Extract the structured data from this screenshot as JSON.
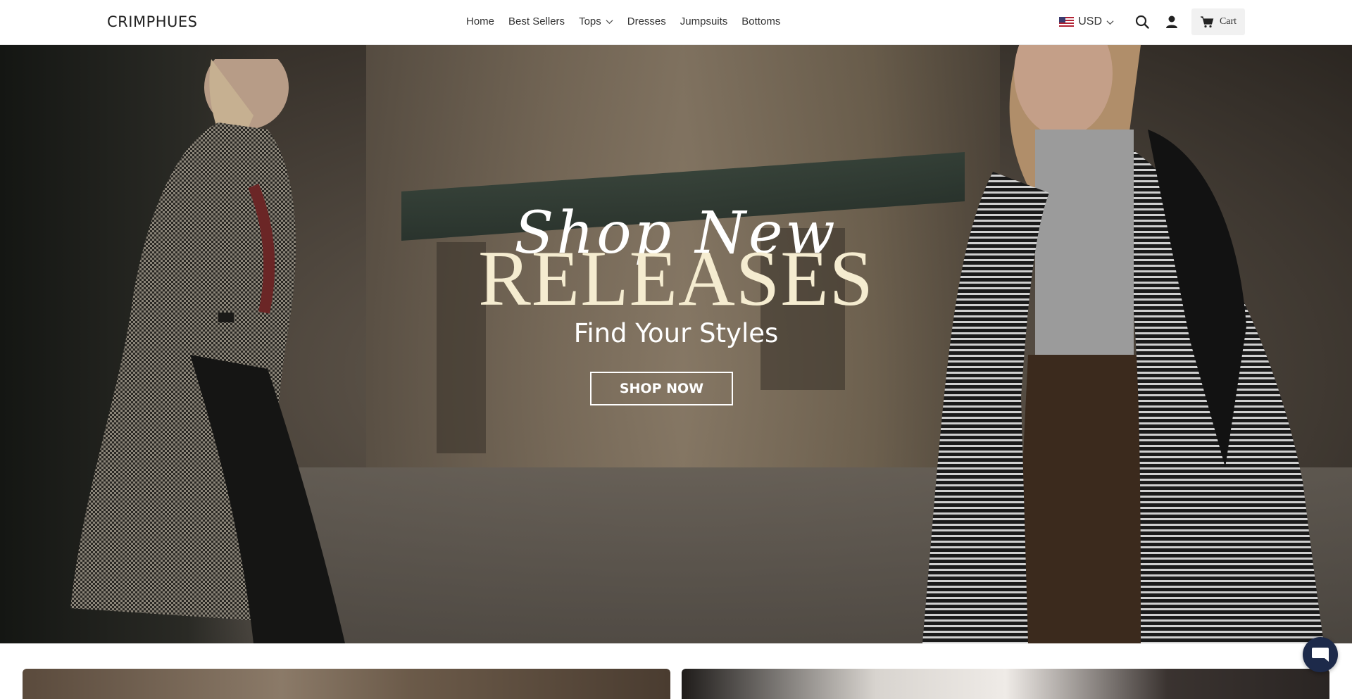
{
  "header": {
    "logo": "CRIMPHUES",
    "nav": [
      {
        "label": "Home"
      },
      {
        "label": "Best Sellers"
      },
      {
        "label": "Tops",
        "has_dropdown": true
      },
      {
        "label": "Dresses"
      },
      {
        "label": "Jumpsuits"
      },
      {
        "label": "Bottoms"
      }
    ],
    "currency": "USD",
    "currency_flag": "us-flag-icon",
    "cart_label": "Cart"
  },
  "hero": {
    "script_text": "Shop New",
    "headline": "RELEASES",
    "subtitle": "Find Your Styles",
    "cta_label": "SHOP NOW",
    "headline_color": "#f5ecd0"
  },
  "icons": {
    "search": "search-icon",
    "account": "user-icon",
    "cart": "cart-icon",
    "chat": "chat-icon"
  },
  "colors": {
    "chat_bubble": "#1d2a4a",
    "cart_bg": "#f1f1f1"
  }
}
